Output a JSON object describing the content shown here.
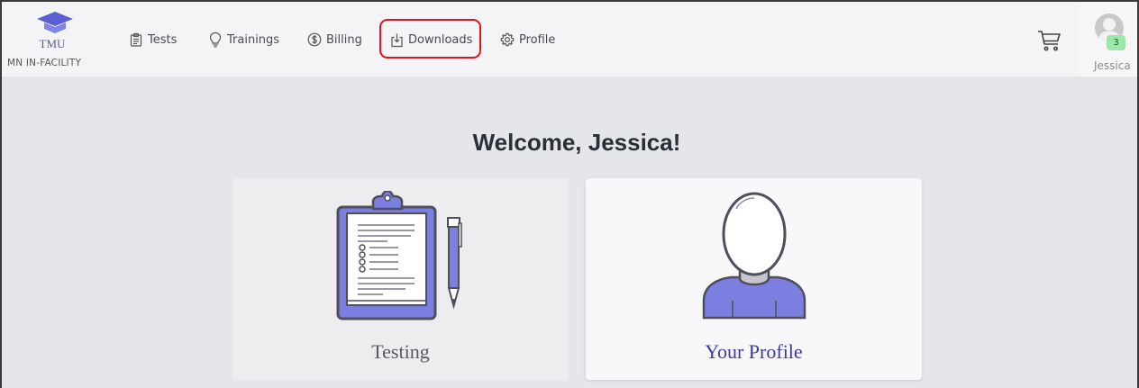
{
  "brand": {
    "name": "TMU",
    "subtitle": "MN IN-FACILITY",
    "icon": "graduation-cap-icon"
  },
  "nav": {
    "items": [
      {
        "label": "Tests",
        "icon": "clipboard-icon"
      },
      {
        "label": "Trainings",
        "icon": "lightbulb-icon"
      },
      {
        "label": "Billing",
        "icon": "dollar-circle-icon"
      },
      {
        "label": "Downloads",
        "icon": "download-icon"
      },
      {
        "label": "Profile",
        "icon": "gear-icon"
      }
    ],
    "highlighted": "Downloads"
  },
  "cart": {
    "icon": "cart-icon"
  },
  "user": {
    "name": "Jessica",
    "badge_count": "3",
    "icon": "avatar-icon"
  },
  "main": {
    "welcome": "Welcome, Jessica!",
    "cards": [
      {
        "label": "Testing",
        "icon": "clipboard-pen-illustration"
      },
      {
        "label": "Your Profile",
        "icon": "person-silhouette-illustration"
      }
    ]
  },
  "colors": {
    "accent": "#3b3aa0",
    "illustration_fill": "#7b7fe0",
    "highlight_border": "#e0141e",
    "badge_bg": "#9be8a8",
    "page_bg": "#e5e6ea"
  }
}
